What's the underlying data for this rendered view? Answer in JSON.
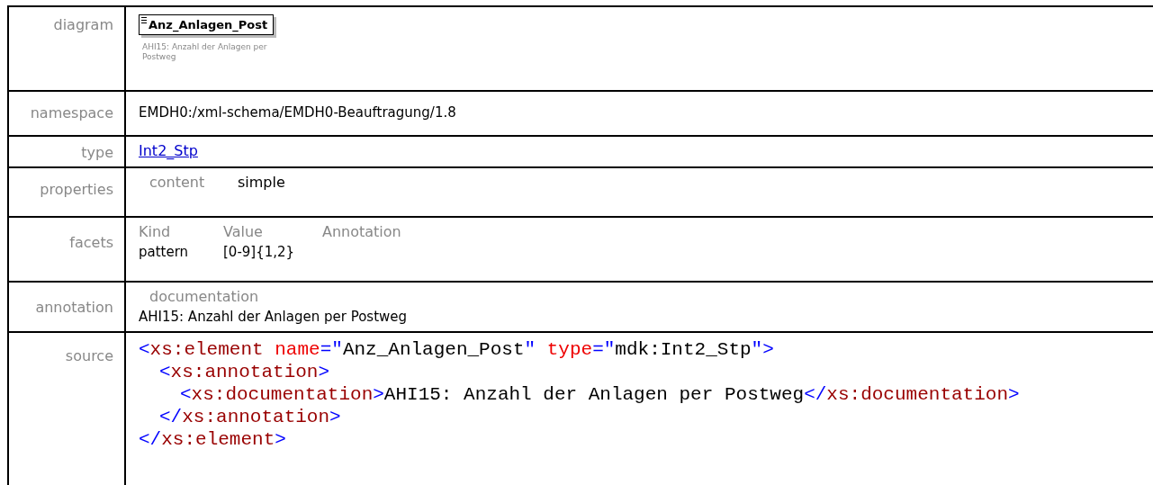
{
  "rows": [
    {
      "kind": "diagram",
      "label": "diagram",
      "element": "Anz_Anlagen_Post",
      "caption": "AHI15: Anzahl der Anlagen per Postweg"
    },
    {
      "kind": "text",
      "label": "namespace",
      "value": "EMDH0:/xml-schema/EMDH0-Beauftragung/1.8"
    },
    {
      "kind": "link",
      "label": "type",
      "value": "Int2_Stp"
    },
    {
      "kind": "pairs",
      "label": "properties",
      "pairs": [
        {
          "key": "content",
          "value": "simple"
        }
      ]
    },
    {
      "kind": "table",
      "label": "facets",
      "columns": [
        "Kind",
        "Value",
        "Annotation"
      ],
      "rows": [
        [
          "pattern",
          "[0-9]{1,2}"
        ]
      ]
    },
    {
      "kind": "doc",
      "label": "annotation",
      "heading": "documentation",
      "value": "AHI15: Anzahl der Anlagen per Postweg"
    },
    {
      "kind": "source",
      "label": "source",
      "code": [
        {
          "open": [
            {
              "kind": "punct",
              "s": "<"
            },
            {
              "kind": "tag",
              "s": "xs:element"
            },
            {
              "kind": "attr",
              "s": " name"
            },
            {
              "kind": "punct",
              "s": "=\""
            },
            {
              "kind": "text",
              "s": "Anz_Anlagen_Post"
            },
            {
              "kind": "punct",
              "s": "\""
            },
            {
              "kind": "attr",
              "s": " type"
            },
            {
              "kind": "punct",
              "s": "=\""
            },
            {
              "kind": "text",
              "s": "mdk:Int2_Stp"
            },
            {
              "kind": "punct",
              "s": "\">"
            }
          ],
          "children": [
            {
              "open": [
                {
                  "kind": "punct",
                  "s": "<"
                },
                {
                  "kind": "tag",
                  "s": "xs:annotation"
                },
                {
                  "kind": "punct",
                  "s": ">"
                }
              ],
              "children": [
                {
                  "open": [
                    {
                      "kind": "punct",
                      "s": "<"
                    },
                    {
                      "kind": "tag",
                      "s": "xs:documentation"
                    },
                    {
                      "kind": "punct",
                      "s": ">"
                    },
                    {
                      "kind": "text",
                      "s": "AHI15: Anzahl der Anlagen per Postweg"
                    },
                    {
                      "kind": "punct",
                      "s": "</"
                    },
                    {
                      "kind": "tag",
                      "s": "xs:documentation"
                    },
                    {
                      "kind": "punct",
                      "s": ">"
                    }
                  ]
                }
              ],
              "close": [
                {
                  "kind": "punct",
                  "s": "</"
                },
                {
                  "kind": "tag",
                  "s": "xs:annotation"
                },
                {
                  "kind": "punct",
                  "s": ">"
                }
              ]
            }
          ],
          "close": [
            {
              "kind": "punct",
              "s": "</"
            },
            {
              "kind": "tag",
              "s": "xs:element"
            },
            {
              "kind": "punct",
              "s": ">"
            }
          ]
        }
      ]
    }
  ]
}
